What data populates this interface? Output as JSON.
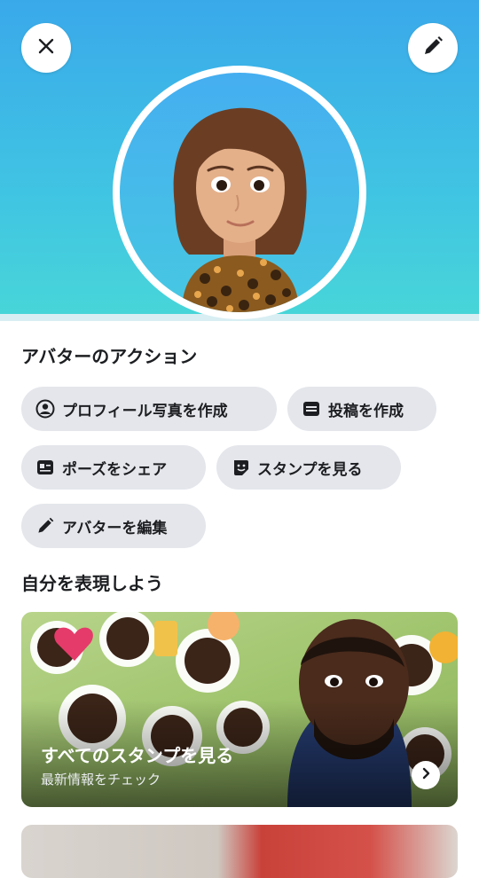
{
  "header": {
    "close_icon": "close-icon",
    "edit_icon": "pencil-icon",
    "gradient_top": "#3aa9ea",
    "gradient_bottom": "#48d6d8"
  },
  "actions": {
    "title": "アバターのアクション",
    "buttons": [
      {
        "label": "プロフィール写真を作成",
        "icon": "profile-circle-icon"
      },
      {
        "label": "投稿を作成",
        "icon": "post-icon"
      },
      {
        "label": "ポーズをシェア",
        "icon": "id-card-icon"
      },
      {
        "label": "スタンプを見る",
        "icon": "sticker-icon"
      },
      {
        "label": "アバターを編集",
        "icon": "pencil-icon"
      }
    ]
  },
  "express": {
    "title": "自分を表現しよう",
    "card": {
      "title": "すべてのスタンプを見る",
      "subtitle": "最新情報をチェック",
      "icon": "chevron-right-icon"
    }
  },
  "colors": {
    "pill_bg": "#e4e6eb",
    "text": "#1c1e21"
  }
}
